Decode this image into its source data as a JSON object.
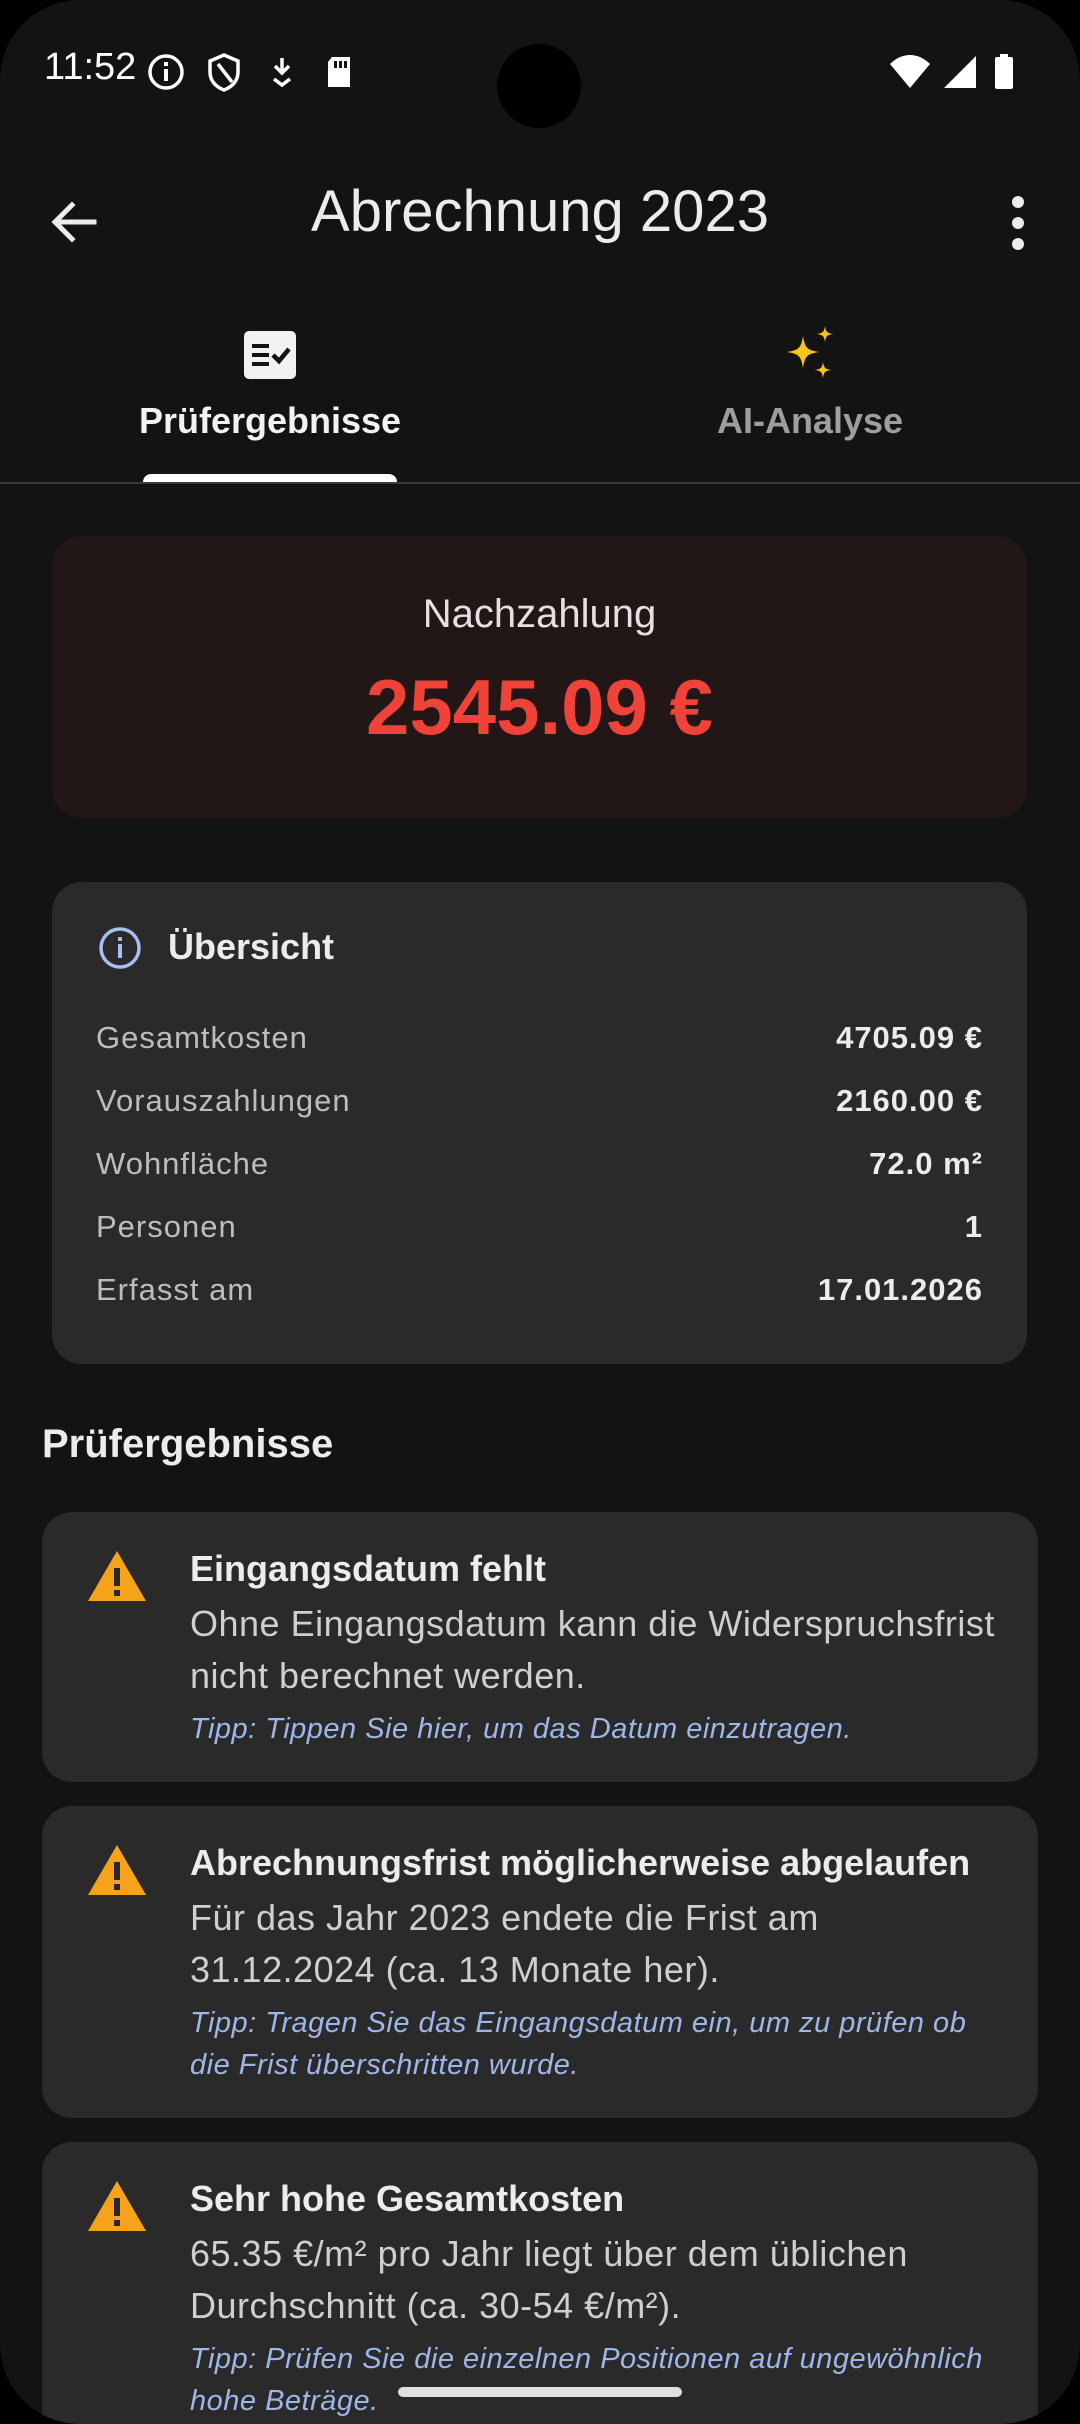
{
  "status_bar": {
    "time": "11:52",
    "left_icons": [
      "info-icon",
      "shield-icon",
      "download-icon",
      "sd-card-icon"
    ],
    "right_icons": [
      "wifi-icon",
      "signal-icon",
      "battery-icon"
    ]
  },
  "app_bar": {
    "title": "Abrechnung 2023",
    "back_icon": "arrow-back-icon",
    "menu_icon": "more-vert-icon"
  },
  "tabs": [
    {
      "label": "Prüfergebnisse",
      "icon": "checklist-icon",
      "active": true
    },
    {
      "label": "AI-Analyse",
      "icon": "sparkles-icon",
      "active": false
    }
  ],
  "balance": {
    "label": "Nachzahlung",
    "amount": "2545.09 €"
  },
  "overview": {
    "title": "Übersicht",
    "rows": [
      {
        "label": "Gesamtkosten",
        "value": "4705.09 €"
      },
      {
        "label": "Vorauszahlungen",
        "value": "2160.00 €"
      },
      {
        "label": "Wohnfläche",
        "value": "72.0 m²"
      },
      {
        "label": "Personen",
        "value": "1"
      },
      {
        "label": "Erfasst am",
        "value": "17.01.2026"
      }
    ]
  },
  "results_heading": "Prüfergebnisse",
  "results": [
    {
      "title": "Eingangsdatum fehlt",
      "body": "Ohne Eingangsdatum kann die Widerspruchsfrist nicht berechnet werden.",
      "tip": "Tipp: Tippen Sie hier, um das Datum einzutragen."
    },
    {
      "title": "Abrechnungsfrist möglicherweise abgelaufen",
      "body": "Für das Jahr 2023 endete die Frist am 31.12.2024 (ca. 13 Monate her).",
      "tip": "Tipp: Tragen Sie das Eingangsdatum ein, um zu prüfen ob die Frist überschritten wurde."
    },
    {
      "title": "Sehr hohe Gesamtkosten",
      "body": "65.35 €/m² pro Jahr liegt über dem üblichen Durchschnitt (ca. 30-54 €/m²).",
      "tip": "Tipp: Prüfen Sie die einzelnen Positionen auf ungewöhnlich hohe Beträge."
    }
  ],
  "colors": {
    "background": "#131313",
    "card": "#2a2a2a",
    "balance_card": "#221617",
    "amount_red": "#ef4238",
    "warning_orange": "#f7a21b",
    "tip_blue": "#9eb6e8",
    "sparkle_yellow": "#f5c518"
  }
}
